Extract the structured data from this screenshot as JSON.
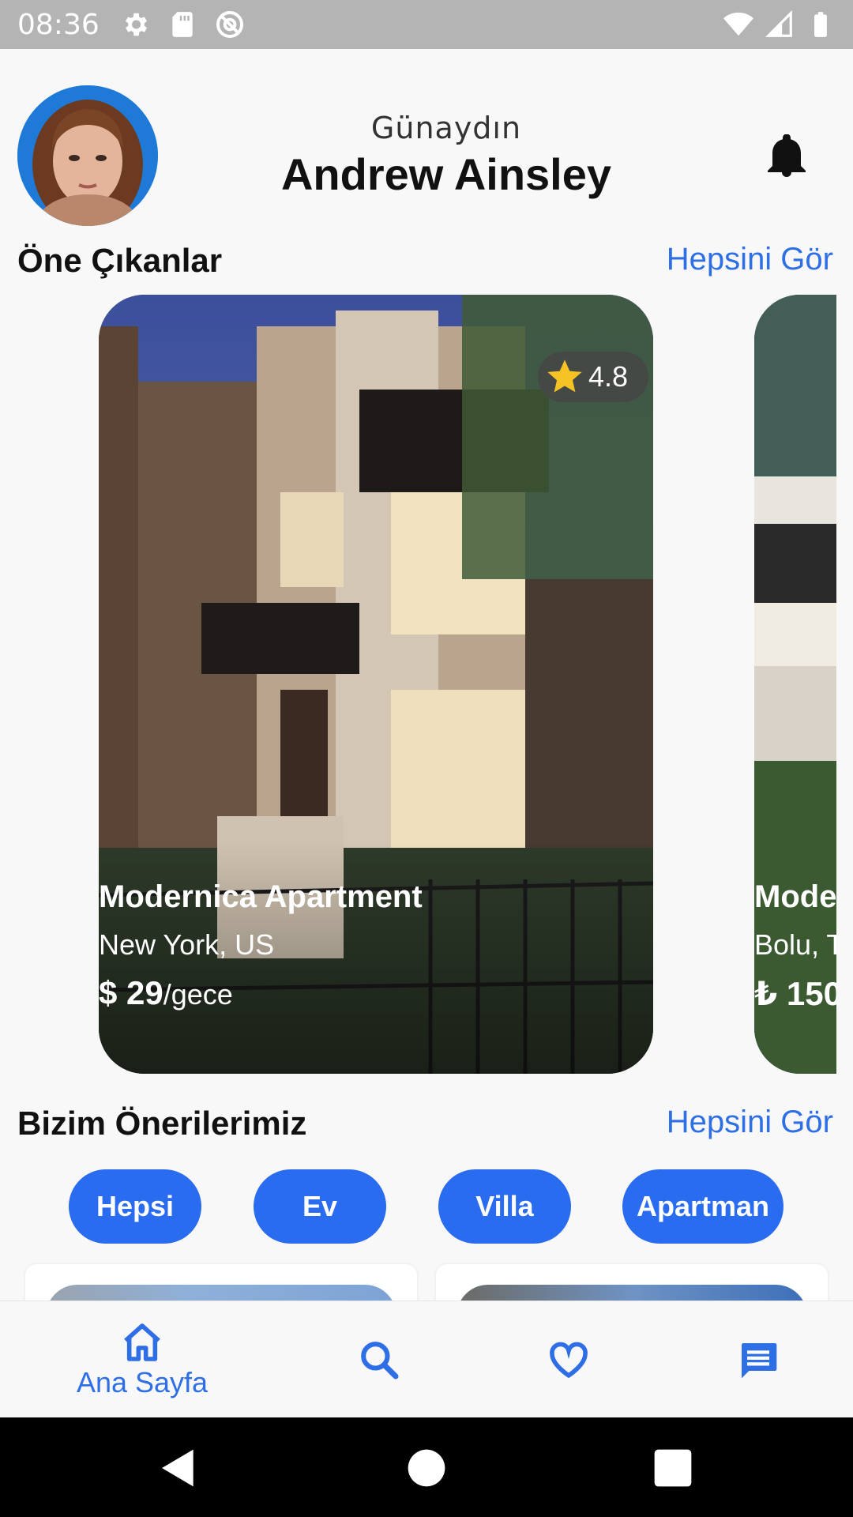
{
  "status_bar": {
    "time": "08:36",
    "left_icons": [
      "gear-icon",
      "sd-card-icon",
      "at-sign-icon"
    ],
    "right_icons": [
      "wifi-icon",
      "cell-signal-icon",
      "battery-icon"
    ]
  },
  "header": {
    "greeting": "Günaydın",
    "user_name": "Andrew Ainsley",
    "avatar": "avatar-icon",
    "notification_icon": "bell-icon"
  },
  "featured": {
    "title": "Öne Çıkanlar",
    "see_all": "Hepsini Gör",
    "cards": [
      {
        "rating": "4.8",
        "name": "Modernica Apartment",
        "location": "New York, US",
        "price": "$ 29",
        "price_unit": "/gece"
      },
      {
        "name": "Mode",
        "location": "Bolu, T",
        "price": "₺ 150"
      }
    ]
  },
  "recommendations": {
    "title": "Bizim Önerilerimiz",
    "see_all": "Hepsini Gör",
    "filters": [
      "Hepsi",
      "Ev",
      "Villa",
      "Apartman"
    ]
  },
  "bottom_nav": {
    "items": [
      {
        "icon": "home-icon",
        "label": "Ana Sayfa",
        "active": true
      },
      {
        "icon": "search-icon",
        "label": ""
      },
      {
        "icon": "heart-icon",
        "label": ""
      },
      {
        "icon": "message-icon",
        "label": ""
      }
    ]
  },
  "system_nav": [
    "back-icon",
    "home-circle-icon",
    "recents-icon"
  ],
  "colors": {
    "accent": "#2a6cf0",
    "link": "#2f6fe6",
    "status_bar": "#b4b4b4",
    "background": "#f8f8f8"
  }
}
